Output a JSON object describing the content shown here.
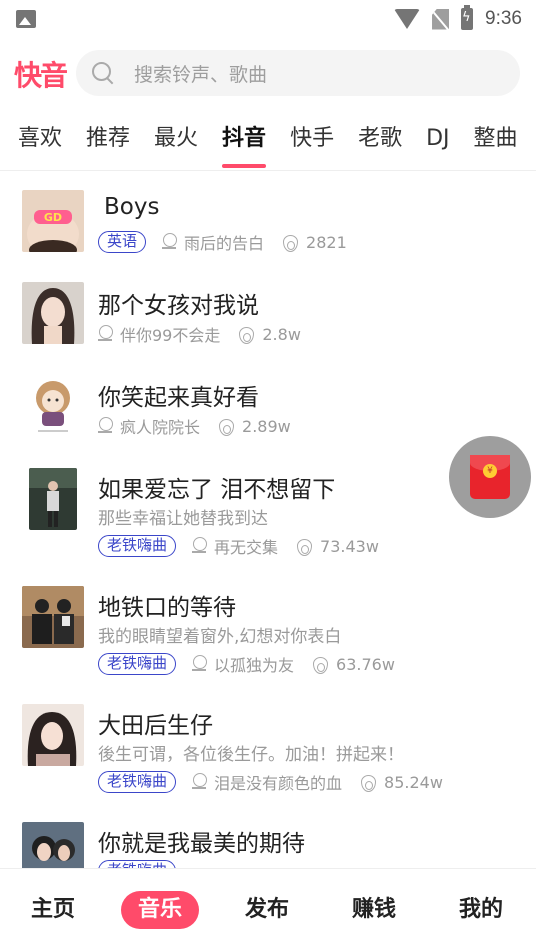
{
  "status_bar": {
    "time": "9:36",
    "icons": [
      "gallery-icon",
      "wifi-icon",
      "no-sim-icon",
      "battery-charging-icon"
    ]
  },
  "header": {
    "logo_text": "快音",
    "search_placeholder": "搜索铃声、歌曲",
    "search_icon": "search-icon"
  },
  "tabs": [
    "喜欢",
    "推荐",
    "最火",
    "抖音",
    "快手",
    "老歌",
    "DJ",
    "整曲"
  ],
  "active_tab": "抖音",
  "songs": [
    {
      "title": "Boys",
      "subtitle": "",
      "tag": "英语",
      "artist": "雨后的告白",
      "plays": "2821"
    },
    {
      "title": "那个女孩对我说",
      "subtitle": "",
      "tag": "",
      "artist": "伴你99不会走",
      "plays": "2.8w"
    },
    {
      "title": "你笑起来真好看",
      "subtitle": "",
      "tag": "",
      "artist": "疯人院院长",
      "plays": "2.89w"
    },
    {
      "title": "如果爱忘了 泪不想留下",
      "subtitle": "那些幸福让她替我到达",
      "tag": "老铁嗨曲",
      "artist": "再无交集",
      "plays": "73.43w"
    },
    {
      "title": "地铁口的等待",
      "subtitle": "我的眼睛望着窗外,幻想对你表白",
      "tag": "老铁嗨曲",
      "artist": "以孤独为友",
      "plays": "63.76w"
    },
    {
      "title": "大田后生仔",
      "subtitle": "後生可谓，各位後生仔。加油！拼起来！",
      "tag": "老铁嗨曲",
      "artist": "泪是没有颜色的血",
      "plays": "85.24w"
    },
    {
      "title": "你就是我最美的期待",
      "subtitle": "",
      "tag": "老铁嗨曲",
      "artist": "",
      "plays": ""
    }
  ],
  "floating_button": {
    "icon": "red-packet-icon"
  },
  "bottom_nav": [
    "主页",
    "音乐",
    "发布",
    "赚钱",
    "我的"
  ],
  "active_nav": "音乐",
  "colors": {
    "accent": "#ff4b6a",
    "tag_border": "#3b46c9",
    "meta_text": "#9a9a9a"
  }
}
